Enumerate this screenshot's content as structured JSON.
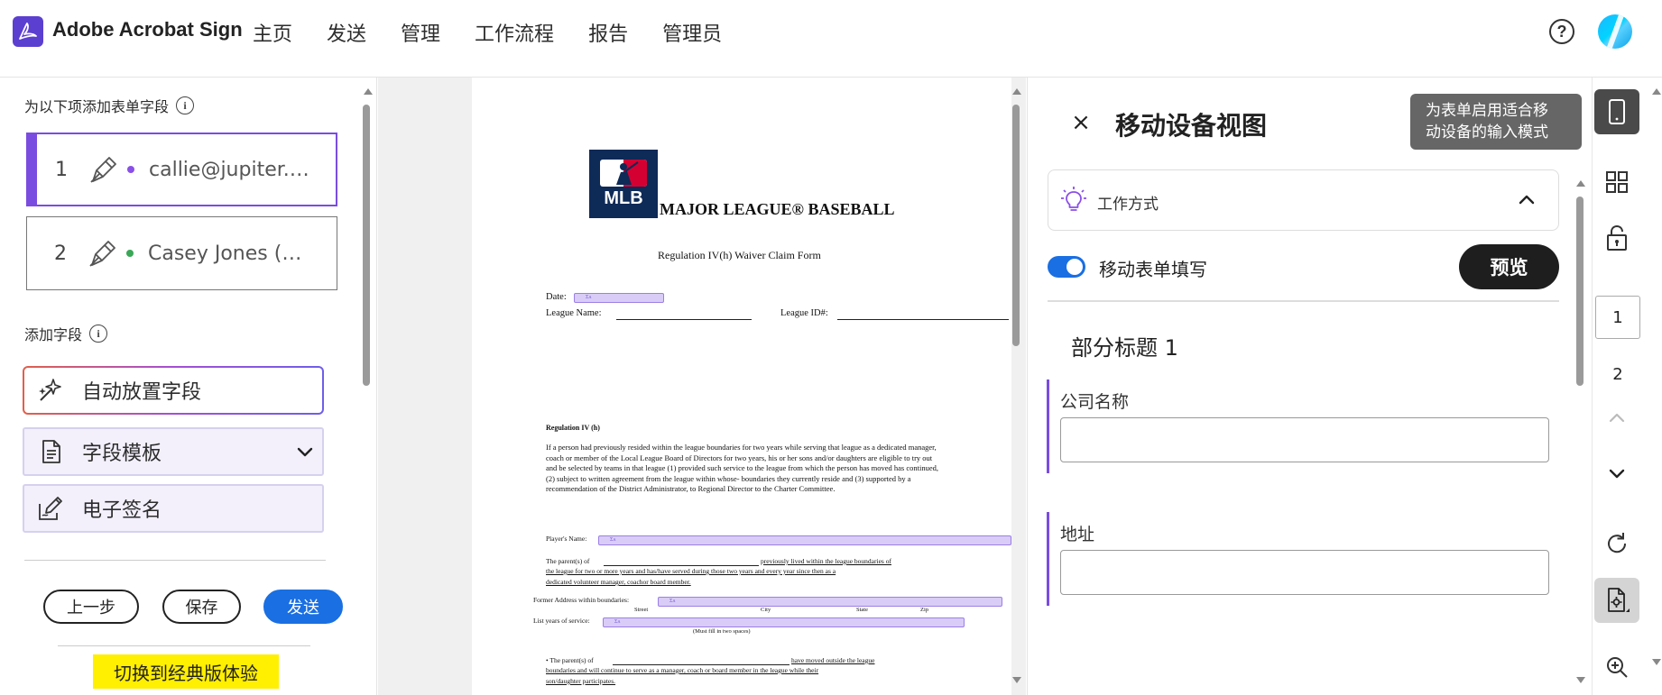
{
  "header": {
    "app_name": "Adobe Acrobat Sign",
    "nav": [
      "主页",
      "发送",
      "管理",
      "工作流程",
      "报告",
      "管理员"
    ],
    "help_icon": "help-icon",
    "help_glyph": "?",
    "avatar": "avatar"
  },
  "left": {
    "add_form_fields_for": "为以下项添加表单字段",
    "recipients": [
      {
        "index": "1",
        "name": "callie@jupiter.…",
        "dot_color": "#8a4fe8",
        "active": true
      },
      {
        "index": "2",
        "name": "Casey Jones (…",
        "dot_color": "#3aa757",
        "active": false
      }
    ],
    "add_fields_title": "添加字段",
    "auto_place": "自动放置字段",
    "field_template": "字段模板",
    "e_signature": "电子签名",
    "back_button": "上一步",
    "save_button": "保存",
    "send_button": "发送",
    "classic_link": "切换到经典版体验"
  },
  "document": {
    "mlb_logo_text": "MLB",
    "title": "MAJOR LEAGUE® BASEBALL",
    "subtitle": "Regulation IV(h) Waiver Claim Form",
    "date_label": "Date:",
    "field_placeholder": "Σᴀ",
    "league_name_label": "League Name:",
    "league_id_label": "League ID#:",
    "regulation_heading": "Regulation IV (h)",
    "regulation_text": "If a person had previously resided within the league boundaries for two years while serving that league as a dedicated manager, coach or member of the Local League Board of Directors for two years, his or her sons and/or daughters are eligible to try out and be selected by teams in that league (1) provided such service to the league from which the person has moved has continued, (2) subject to written agreement from the league within whose- boundaries they currently reside and (3) supported by a recommendation of the District Administrator, to Regional Director to the Charter Committee.",
    "players_name_label": "Player's Name:",
    "parents_text_1": "The parent(s) of",
    "parents_text_1b": "previously lived within the league boundaries of",
    "parents_text_2": "the league for two or more years and has/have served during those two years and every year since then as a",
    "parents_text_3": "dedicated volunteer manager, coachor board member.",
    "former_address_label": "Former Address within boundaries:",
    "address_sublabels": [
      "Street",
      "City",
      "State",
      "Zip"
    ],
    "list_years_label": "List years of service:",
    "must_fill_note": "(Must fill in two spaces)",
    "bullet_text_1": "• The parent(s) of",
    "bullet_text_1b": "have moved outside the league",
    "bullet_text_2": "boundaries and will continue to serve as a manager, coach or board member in the league while their",
    "bullet_text_3": "son/daughter participates."
  },
  "panel": {
    "close_glyph": "×",
    "title": "移动设备视图",
    "how_it_works": "工作方式",
    "mobile_fill_label": "移动表单填写",
    "mobile_fill_on": true,
    "preview_button": "预览",
    "section_title": "部分标题 1",
    "fields": [
      {
        "label": "公司名称",
        "value": ""
      },
      {
        "label": "地址",
        "value": ""
      }
    ]
  },
  "tooltip": {
    "text_line1": "为表单启用适合移",
    "text_line2": "动设备的输入模式"
  },
  "rail": {
    "mobile_icon": "mobile-view-icon",
    "pages": [
      "1",
      "2"
    ],
    "current_page": "1"
  },
  "colors": {
    "accent_purple": "#7a4ce0",
    "primary_blue": "#1a6fe2",
    "field_purple": "#d9ccf7",
    "classic_yellow": "#ffef00"
  }
}
